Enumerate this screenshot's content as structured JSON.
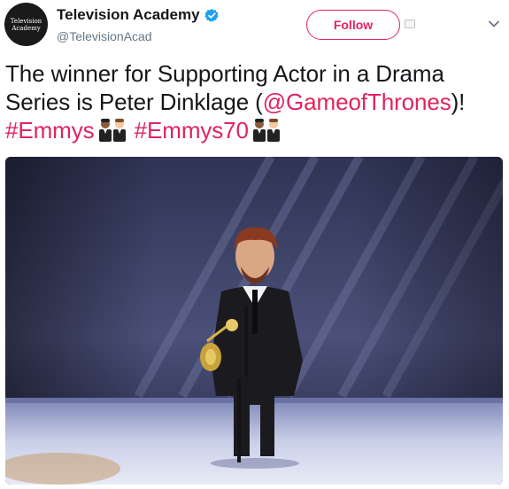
{
  "account": {
    "display_name": "Television Academy",
    "handle": "@TelevisionAcad",
    "avatar_text_line1": "Television",
    "avatar_text_line2": "Academy",
    "verified_icon": "verified-badge-icon"
  },
  "actions": {
    "follow_label": "Follow",
    "menu_icon": "chevron-down-icon"
  },
  "tweet": {
    "text_part1": "The winner for Supporting Actor in a Drama Series is Peter Dinklage (",
    "mention": "@GameofThrones",
    "text_part2": ")! ",
    "hashtag1": "#Emmys",
    "hashtag2": "#Emmys70",
    "emoji_icon": "emmy-men-emoji-icon"
  },
  "colors": {
    "accent": "#e0245e",
    "verified": "#1da1f2",
    "text": "#14171a",
    "secondary": "#657786"
  },
  "media": {
    "photo_icon": "stage-photo-image"
  }
}
